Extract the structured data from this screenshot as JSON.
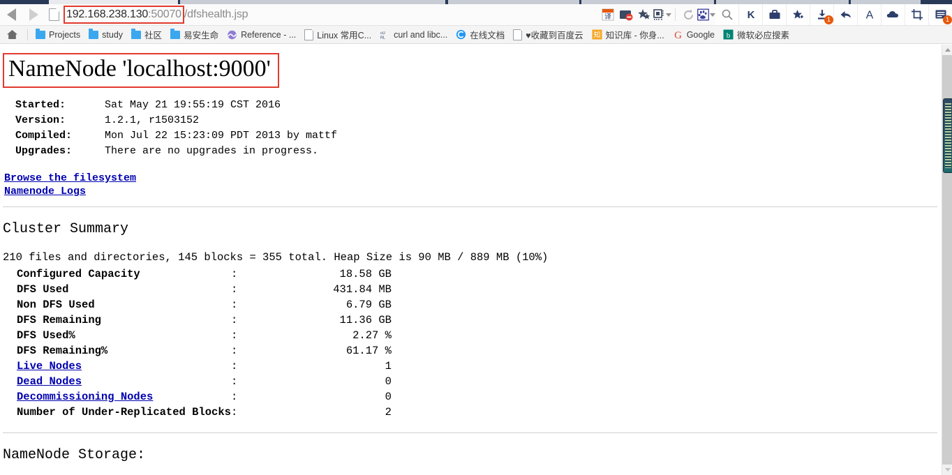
{
  "browser": {
    "nav": {
      "back_icon": "back-arrow-icon",
      "forward_icon": "forward-arrow-icon",
      "page_icon": "page-document-icon"
    },
    "address": {
      "host": "192.168.238.130",
      "port": ":50070",
      "path": "/dfshealth.jsp",
      "full": "192.168.238.130:50070/dfshealth.jsp",
      "highlight_color": "#e23a2e"
    },
    "toolbar_icons": [
      {
        "name": "translate-icon",
        "glyph": "译"
      },
      {
        "name": "adblock-icon",
        "glyph": "⛔"
      },
      {
        "name": "favorites-star-icon",
        "glyph": "★"
      },
      {
        "name": "qrcode-icon",
        "glyph": "▦"
      },
      {
        "name": "reload-icon",
        "glyph": "⟳"
      },
      {
        "name": "baidu-paw-icon",
        "glyph": "❀"
      }
    ],
    "right_icons": [
      {
        "name": "search-icon",
        "glyph": "🔍",
        "badge": ""
      },
      {
        "name": "kingsoft-k-icon",
        "glyph": "K",
        "badge": ""
      },
      {
        "name": "briefcase-icon",
        "glyph": "💼",
        "badge": ""
      },
      {
        "name": "star-plus-icon",
        "glyph": "✦",
        "badge": ""
      },
      {
        "name": "download-icon",
        "glyph": "⤓",
        "badge": "1"
      },
      {
        "name": "undo-arrow-icon",
        "glyph": "↩",
        "badge": ""
      },
      {
        "name": "font-size-icon",
        "glyph": "A",
        "badge": ""
      },
      {
        "name": "cloud-icon",
        "glyph": "☁",
        "badge": ""
      },
      {
        "name": "screenshot-crop-icon",
        "glyph": "⛶",
        "badge": ""
      },
      {
        "name": "reading-list-icon",
        "glyph": "▤",
        "badge": "1"
      }
    ],
    "bookmarks": [
      {
        "name": "bookmark-home",
        "label": "",
        "icon": "home-icon"
      },
      {
        "name": "bookmark-projects",
        "label": "Projects",
        "icon": "folder-icon"
      },
      {
        "name": "bookmark-study",
        "label": "study",
        "icon": "folder-icon"
      },
      {
        "name": "bookmark-shequ",
        "label": "社区",
        "icon": "folder-icon"
      },
      {
        "name": "bookmark-yianshengming",
        "label": "易安生命",
        "icon": "folder-icon"
      },
      {
        "name": "bookmark-reference",
        "label": "Reference - ...",
        "icon": "reference-icon"
      },
      {
        "name": "bookmark-linux",
        "label": "Linux 常用C...",
        "icon": "doc-icon"
      },
      {
        "name": "bookmark-curl",
        "label": "curl and libc...",
        "icon": "curl-icon"
      },
      {
        "name": "bookmark-online-doc",
        "label": "在线文档",
        "icon": "c-circle-icon"
      },
      {
        "name": "bookmark-baiduyun",
        "label": "♥收藏到百度云",
        "icon": "doc-icon"
      },
      {
        "name": "bookmark-zhishiku",
        "label": "知识库 - 你身...",
        "icon": "zhi-icon"
      },
      {
        "name": "bookmark-google",
        "label": "Google",
        "icon": "google-g-icon"
      },
      {
        "name": "bookmark-bing",
        "label": "微软必应搜素",
        "icon": "bing-b-icon"
      }
    ]
  },
  "page": {
    "title": "NameNode 'localhost:9000'",
    "meta": [
      {
        "key": "Started:",
        "value": "Sat May 21 19:55:19 CST 2016"
      },
      {
        "key": "Version:",
        "value": "1.2.1, r1503152"
      },
      {
        "key": "Compiled:",
        "value": "Mon Jul 22 15:23:09 PDT 2013 by mattf"
      },
      {
        "key": "Upgrades:",
        "value": "There are no upgrades in progress."
      }
    ],
    "links": [
      {
        "name": "browse-filesystem-link",
        "label": "Browse the filesystem"
      },
      {
        "name": "namenode-logs-link",
        "label": "Namenode Logs"
      }
    ],
    "cluster_summary": {
      "heading": "Cluster Summary",
      "summary_line": "210 files and directories, 145 blocks = 355 total. Heap Size is 90 MB / 889 MB (10%)",
      "rows": [
        {
          "label": "Configured Capacity",
          "colon": ":",
          "value": "18.58 GB",
          "link": false
        },
        {
          "label": "DFS Used",
          "colon": ":",
          "value": "431.84 MB",
          "link": false
        },
        {
          "label": "Non DFS Used",
          "colon": ":",
          "value": "6.79 GB",
          "link": false
        },
        {
          "label": "DFS Remaining",
          "colon": ":",
          "value": "11.36 GB",
          "link": false
        },
        {
          "label": "DFS Used%",
          "colon": ":",
          "value": "2.27 %",
          "link": false
        },
        {
          "label": "DFS Remaining%",
          "colon": ":",
          "value": "61.17 %",
          "link": false
        },
        {
          "label": "Live Nodes",
          "colon": ":",
          "value": "1",
          "link": true
        },
        {
          "label": "Dead Nodes",
          "colon": ":",
          "value": "0",
          "link": true
        },
        {
          "label": "Decommissioning Nodes",
          "colon": ":",
          "value": "0",
          "link": true
        },
        {
          "label": "Number of Under-Replicated Blocks",
          "colon": ":",
          "value": "2",
          "link": false
        }
      ]
    },
    "storage_heading": "NameNode Storage:"
  }
}
